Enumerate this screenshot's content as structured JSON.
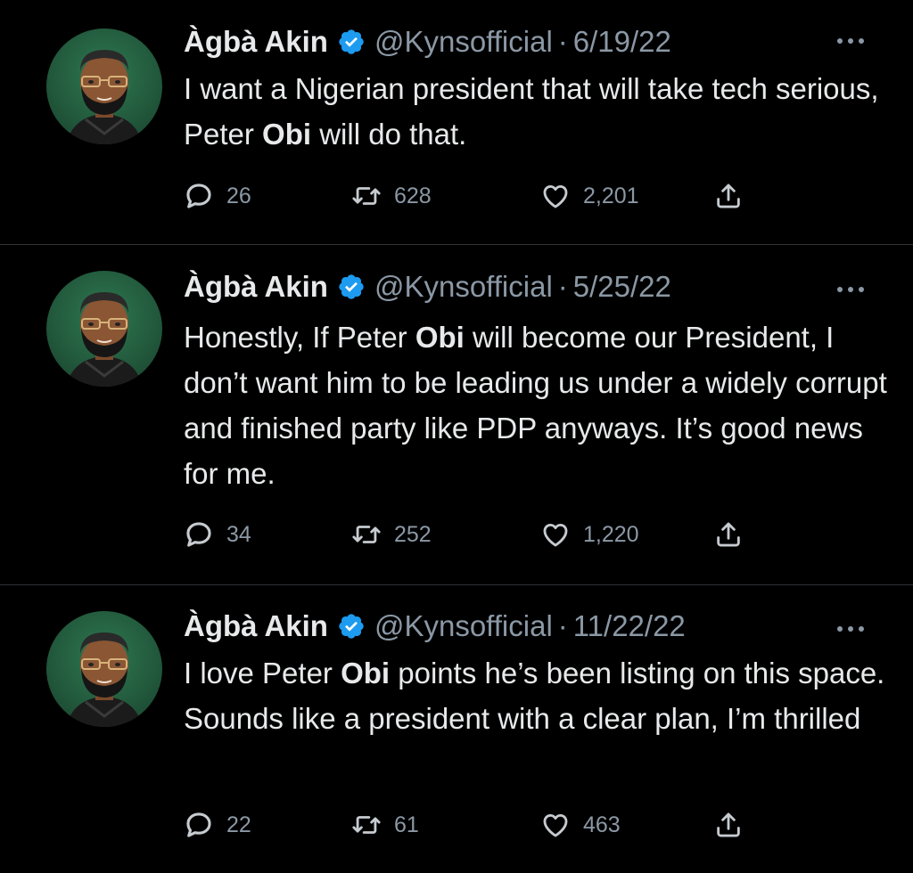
{
  "author": {
    "display_name": "Àgbà Akin",
    "handle": "@Kynsofficial",
    "separator": "·"
  },
  "icons": {
    "verified": "verified-badge-icon",
    "more": "more-options-icon",
    "reply": "reply-icon",
    "retweet": "retweet-icon",
    "like": "like-icon",
    "share": "share-icon"
  },
  "colors": {
    "background": "#000000",
    "text": "#e7e9ea",
    "muted": "#8b98a5",
    "verified": "#1d9bf0",
    "divider": "#2f3336"
  },
  "tweets": [
    {
      "date": "6/19/22",
      "text_parts": [
        "I want a Nigerian president that will take tech serious, Peter ",
        "Obi",
        " will do that."
      ],
      "replies": "26",
      "retweets": "628",
      "likes": "2,201"
    },
    {
      "date": "5/25/22",
      "text_parts": [
        "Honestly, If Peter ",
        "Obi",
        " will become our President, I don’t want him to be leading us under a widely corrupt and finished party like PDP anyways. It’s good news for me."
      ],
      "replies": "34",
      "retweets": "252",
      "likes": "1,220"
    },
    {
      "date": "11/22/22",
      "text_parts": [
        "I love Peter ",
        "Obi",
        " points he’s been listing on this space. Sounds like a president with a clear plan, I’m thrilled"
      ],
      "replies": "22",
      "retweets": "61",
      "likes": "463"
    }
  ]
}
